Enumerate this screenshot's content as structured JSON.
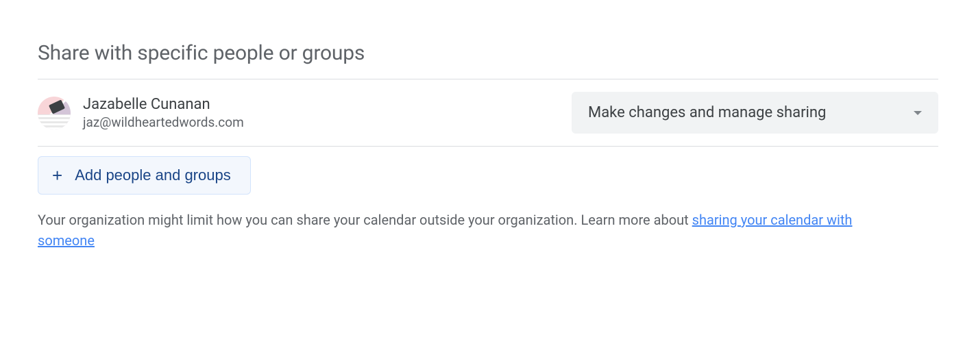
{
  "section": {
    "title": "Share with specific people or groups"
  },
  "person": {
    "name": "Jazabelle Cunanan",
    "email": "jaz@wildheartedwords.com",
    "permission": "Make changes and manage sharing"
  },
  "add_button": {
    "label": "Add people and groups"
  },
  "info": {
    "text": "Your organization might limit how you can share your calendar outside your organization. Learn more about ",
    "link_text": "sharing your calendar with someone"
  }
}
